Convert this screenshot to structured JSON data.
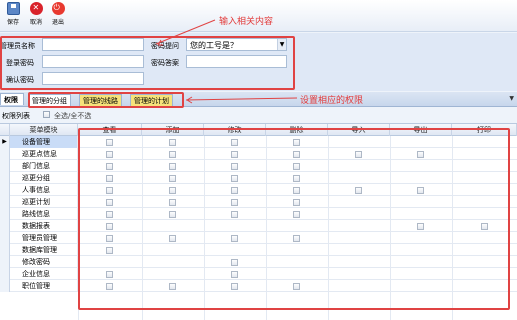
{
  "toolbar": {
    "save_label": "保存",
    "cancel_label": "取消",
    "exit_label": "退出"
  },
  "annotations": {
    "input_note": "输入相关内容",
    "permission_note": "设置相应的权限"
  },
  "form": {
    "admin_name_label": "管理员名称",
    "login_pwd_label": "登录密码",
    "confirm_pwd_label": "确认密码",
    "pwd_question_label": "密码提问",
    "pwd_question_value": "您的工号是？",
    "pwd_answer_label": "密码答案",
    "admin_name_value": "",
    "login_pwd_value": "",
    "confirm_pwd_value": "",
    "pwd_answer_value": ""
  },
  "tabs": {
    "main": "权限",
    "sub": [
      "管理的分组",
      "管理的线路",
      "管理的计划"
    ]
  },
  "list": {
    "title": "权限列表",
    "select_all_label": "全选/全不选"
  },
  "grid": {
    "columns": [
      "菜单模块",
      "查看",
      "添加",
      "修改",
      "删除",
      "导入",
      "导出",
      "打印"
    ],
    "rows": [
      {
        "name": "设备管理",
        "perms": [
          true,
          true,
          true,
          true,
          false,
          false,
          false
        ]
      },
      {
        "name": "巡更点信息",
        "perms": [
          true,
          true,
          true,
          true,
          true,
          true,
          false
        ]
      },
      {
        "name": "部门信息",
        "perms": [
          true,
          true,
          true,
          true,
          false,
          false,
          false
        ]
      },
      {
        "name": "巡更分组",
        "perms": [
          true,
          true,
          true,
          true,
          false,
          false,
          false
        ]
      },
      {
        "name": "人事信息",
        "perms": [
          true,
          true,
          true,
          true,
          true,
          true,
          false
        ]
      },
      {
        "name": "巡更计划",
        "perms": [
          true,
          true,
          true,
          true,
          false,
          false,
          false
        ]
      },
      {
        "name": "路线信息",
        "perms": [
          true,
          true,
          true,
          true,
          false,
          false,
          false
        ]
      },
      {
        "name": "数据报表",
        "perms": [
          true,
          false,
          false,
          false,
          false,
          true,
          true
        ]
      },
      {
        "name": "管理员管理",
        "perms": [
          true,
          true,
          true,
          true,
          false,
          false,
          false
        ]
      },
      {
        "name": "数据库管理",
        "perms": [
          true,
          false,
          false,
          false,
          false,
          false,
          false
        ]
      },
      {
        "name": "修改密码",
        "perms": [
          false,
          false,
          true,
          false,
          false,
          false,
          false
        ]
      },
      {
        "name": "企业信息",
        "perms": [
          true,
          false,
          true,
          false,
          false,
          false,
          false
        ]
      },
      {
        "name": "职位管理",
        "perms": [
          true,
          true,
          true,
          true,
          false,
          false,
          false
        ]
      }
    ]
  },
  "colors": {
    "annotation": "#e23b3b",
    "selected_row": "#c9dcf7",
    "subtab": "#f6e27a"
  }
}
